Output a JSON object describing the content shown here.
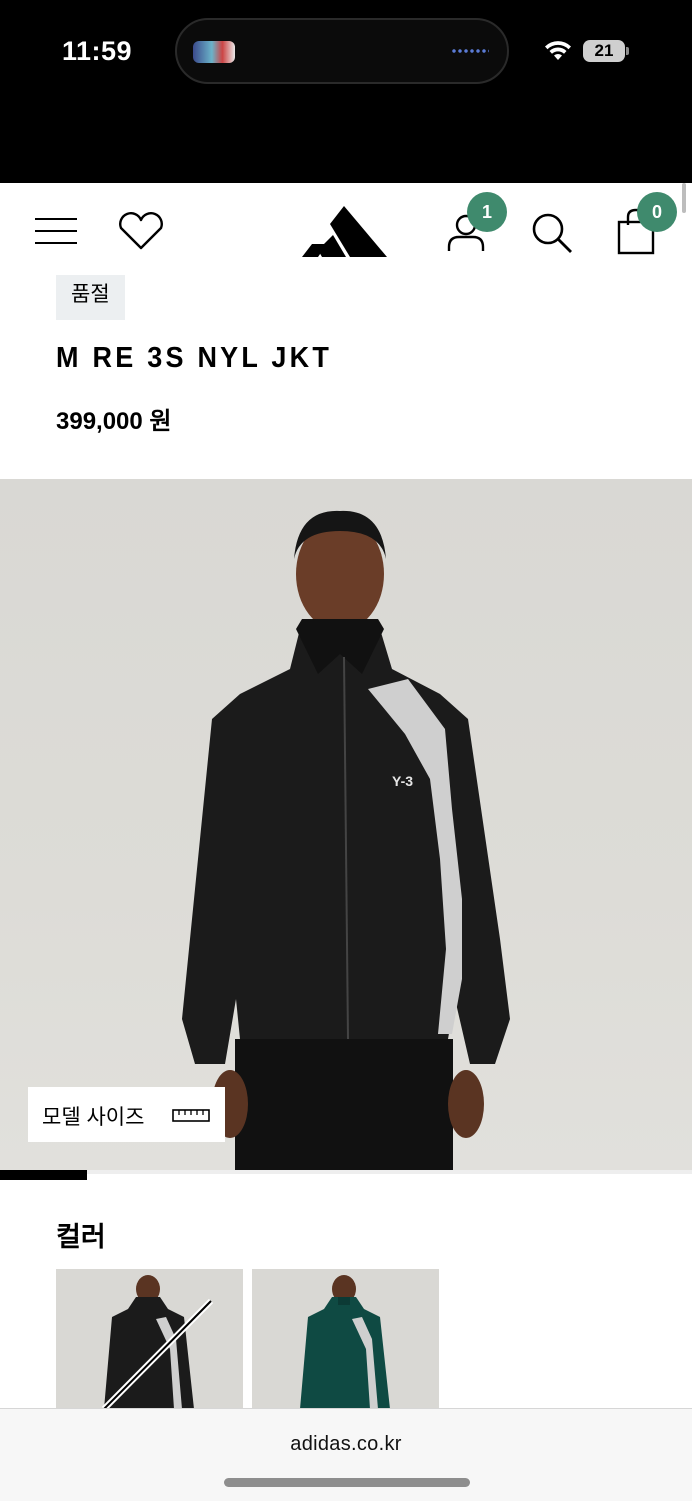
{
  "status_bar": {
    "time": "11:59",
    "battery": "21"
  },
  "header": {
    "wishlist_count_badge": "1",
    "cart_count": "0"
  },
  "product": {
    "badge": "품절",
    "name": "M RE 3S NYL JKT",
    "price": "399,000 원",
    "image_logo_text": "Y-3",
    "model_size_label": "모델 사이즈",
    "gallery_progress_fraction": 0.125
  },
  "color_section": {
    "heading": "컬러",
    "swatches": [
      {
        "color": "black",
        "available": false
      },
      {
        "color": "dark green",
        "available": true
      }
    ]
  },
  "browser": {
    "url": "adidas.co.kr"
  },
  "colors": {
    "badge_green": "#3f8a6d",
    "soldout_bg": "#eceff1",
    "jacket_black": "#1b1b1b",
    "jacket_green": "#0f4a43"
  }
}
